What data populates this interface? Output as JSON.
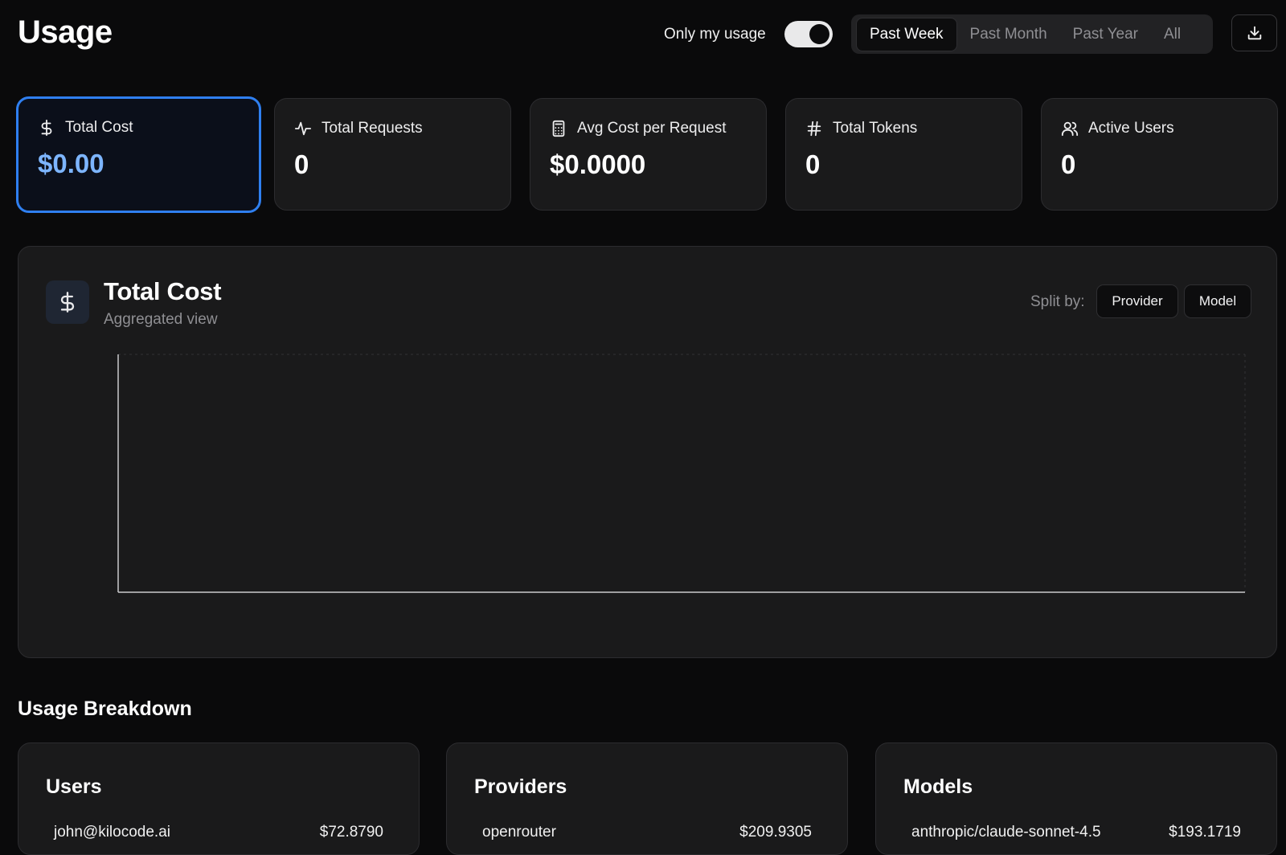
{
  "header": {
    "title": "Usage",
    "toggle_label": "Only my usage",
    "toggle_on": true,
    "ranges": [
      "Past Week",
      "Past Month",
      "Past Year",
      "All"
    ],
    "active_range": "Past Week"
  },
  "stats": [
    {
      "label": "Total Cost",
      "value": "$0.00",
      "icon": "dollar-icon"
    },
    {
      "label": "Total Requests",
      "value": "0",
      "icon": "activity-icon"
    },
    {
      "label": "Avg Cost per Request",
      "value": "$0.0000",
      "icon": "calculator-icon"
    },
    {
      "label": "Total Tokens",
      "value": "0",
      "icon": "hash-icon"
    },
    {
      "label": "Active Users",
      "value": "0",
      "icon": "users-icon"
    }
  ],
  "chart": {
    "title": "Total Cost",
    "subtitle": "Aggregated view",
    "split_label": "Split by:",
    "split_options": [
      "Provider",
      "Model"
    ]
  },
  "chart_data": {
    "type": "line",
    "title": "Total Cost",
    "subtitle": "Aggregated view",
    "series": [],
    "x": [],
    "grid": true
  },
  "breakdown": {
    "title": "Usage Breakdown",
    "cards": [
      {
        "title": "Users",
        "row_label": "john@kilocode.ai",
        "row_value": "$72.8790"
      },
      {
        "title": "Providers",
        "row_label": "openrouter",
        "row_value": "$209.9305"
      },
      {
        "title": "Models",
        "row_label": "anthropic/claude-sonnet-4.5",
        "row_value": "$193.1719"
      }
    ]
  },
  "colors": {
    "accent": "#2f7ff0",
    "accent_value": "#7db5ff",
    "background": "#0a0a0b",
    "card": "#1a1a1b"
  }
}
